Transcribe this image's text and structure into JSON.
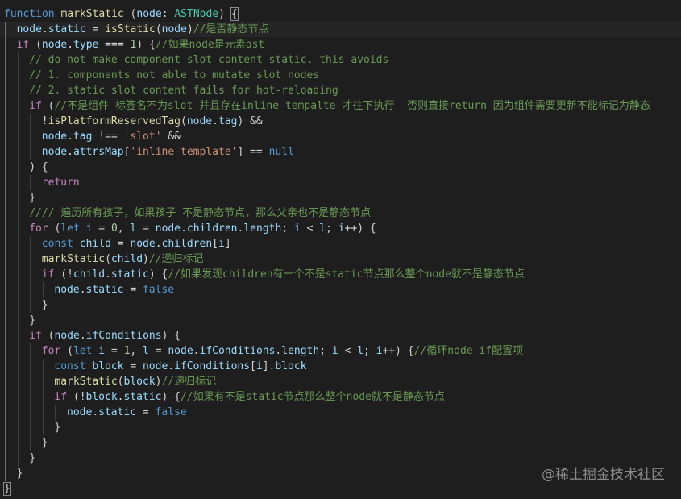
{
  "watermark": "@稀土掘金技术社区",
  "colors": {
    "background": "#1e1e1e",
    "keyword": "#569cd6",
    "control": "#c586c0",
    "function": "#dcdcaa",
    "variable": "#9cdcfe",
    "type": "#4ec9b0",
    "number": "#b5cea8",
    "string": "#ce9178",
    "comment": "#6a9955"
  },
  "lines": [
    {
      "indent": 0,
      "tokens": [
        [
          "kw",
          "function"
        ],
        [
          "pun",
          " "
        ],
        [
          "fn",
          "markStatic"
        ],
        [
          "pun",
          " ("
        ],
        [
          "var",
          "node"
        ],
        [
          "pun",
          ": "
        ],
        [
          "ty",
          "ASTNode"
        ],
        [
          "pun",
          ") {"
        ]
      ]
    },
    {
      "indent": 1,
      "tokens": [
        [
          "var",
          "node"
        ],
        [
          "pun",
          "."
        ],
        [
          "var",
          "static"
        ],
        [
          "pun",
          " = "
        ],
        [
          "fn",
          "isStatic"
        ],
        [
          "pun",
          "("
        ],
        [
          "var",
          "node"
        ],
        [
          "pun",
          ")"
        ],
        [
          "cmt",
          "//是否静态节点"
        ]
      ]
    },
    {
      "indent": 1,
      "tokens": [
        [
          "ctl",
          "if"
        ],
        [
          "pun",
          " ("
        ],
        [
          "var",
          "node"
        ],
        [
          "pun",
          "."
        ],
        [
          "var",
          "type"
        ],
        [
          "pun",
          " === "
        ],
        [
          "num",
          "1"
        ],
        [
          "pun",
          ") {"
        ],
        [
          "cmt",
          "//如果node是元素ast"
        ]
      ]
    },
    {
      "indent": 2,
      "tokens": [
        [
          "cmt",
          "// do not make component slot content static. this avoids"
        ]
      ]
    },
    {
      "indent": 2,
      "tokens": [
        [
          "cmt",
          "// 1. components not able to mutate slot nodes"
        ]
      ]
    },
    {
      "indent": 2,
      "tokens": [
        [
          "cmt",
          "// 2. static slot content fails for hot-reloading"
        ]
      ]
    },
    {
      "indent": 2,
      "tokens": [
        [
          "ctl",
          "if"
        ],
        [
          "pun",
          " ("
        ],
        [
          "cmt",
          "//不是组件 标签名不为slot 并且存在inline-tempalte 才往下执行  否则直接return 因为组件需要更新不能标记为静态"
        ]
      ]
    },
    {
      "indent": 3,
      "tokens": [
        [
          "pun",
          "!"
        ],
        [
          "fn",
          "isPlatformReservedTag"
        ],
        [
          "pun",
          "("
        ],
        [
          "var",
          "node"
        ],
        [
          "pun",
          "."
        ],
        [
          "var",
          "tag"
        ],
        [
          "pun",
          ") &&"
        ]
      ]
    },
    {
      "indent": 3,
      "tokens": [
        [
          "var",
          "node"
        ],
        [
          "pun",
          "."
        ],
        [
          "var",
          "tag"
        ],
        [
          "pun",
          " !== "
        ],
        [
          "str",
          "'slot'"
        ],
        [
          "pun",
          " &&"
        ]
      ]
    },
    {
      "indent": 3,
      "tokens": [
        [
          "var",
          "node"
        ],
        [
          "pun",
          "."
        ],
        [
          "var",
          "attrsMap"
        ],
        [
          "pun",
          "["
        ],
        [
          "str",
          "'inline-template'"
        ],
        [
          "pun",
          "] == "
        ],
        [
          "kw",
          "null"
        ]
      ]
    },
    {
      "indent": 2,
      "tokens": [
        [
          "pun",
          ") {"
        ]
      ]
    },
    {
      "indent": 3,
      "tokens": [
        [
          "ctl",
          "return"
        ]
      ]
    },
    {
      "indent": 2,
      "tokens": [
        [
          "pun",
          "}"
        ]
      ]
    },
    {
      "indent": 2,
      "tokens": [
        [
          "cmt",
          "//// 遍历所有孩子，如果孩子 不是静态节点，那么父亲也不是静态节点"
        ]
      ]
    },
    {
      "indent": 2,
      "tokens": [
        [
          "ctl",
          "for"
        ],
        [
          "pun",
          " ("
        ],
        [
          "kw",
          "let"
        ],
        [
          "pun",
          " "
        ],
        [
          "var",
          "i"
        ],
        [
          "pun",
          " = "
        ],
        [
          "num",
          "0"
        ],
        [
          "pun",
          ", "
        ],
        [
          "var",
          "l"
        ],
        [
          "pun",
          " = "
        ],
        [
          "var",
          "node"
        ],
        [
          "pun",
          "."
        ],
        [
          "var",
          "children"
        ],
        [
          "pun",
          "."
        ],
        [
          "var",
          "length"
        ],
        [
          "pun",
          "; "
        ],
        [
          "var",
          "i"
        ],
        [
          "pun",
          " < "
        ],
        [
          "var",
          "l"
        ],
        [
          "pun",
          "; "
        ],
        [
          "var",
          "i"
        ],
        [
          "pun",
          "++) {"
        ]
      ]
    },
    {
      "indent": 3,
      "tokens": [
        [
          "kw",
          "const"
        ],
        [
          "pun",
          " "
        ],
        [
          "var",
          "child"
        ],
        [
          "pun",
          " = "
        ],
        [
          "var",
          "node"
        ],
        [
          "pun",
          "."
        ],
        [
          "var",
          "children"
        ],
        [
          "pun",
          "["
        ],
        [
          "var",
          "i"
        ],
        [
          "pun",
          "]"
        ]
      ]
    },
    {
      "indent": 3,
      "tokens": [
        [
          "fn",
          "markStatic"
        ],
        [
          "pun",
          "("
        ],
        [
          "var",
          "child"
        ],
        [
          "pun",
          ")"
        ],
        [
          "cmt",
          "//递归标记"
        ]
      ]
    },
    {
      "indent": 3,
      "tokens": [
        [
          "ctl",
          "if"
        ],
        [
          "pun",
          " (!"
        ],
        [
          "var",
          "child"
        ],
        [
          "pun",
          "."
        ],
        [
          "var",
          "static"
        ],
        [
          "pun",
          ") {"
        ],
        [
          "cmt",
          "//如果发现children有一个不是static节点那么整个node就不是静态节点"
        ]
      ]
    },
    {
      "indent": 4,
      "tokens": [
        [
          "var",
          "node"
        ],
        [
          "pun",
          "."
        ],
        [
          "var",
          "static"
        ],
        [
          "pun",
          " = "
        ],
        [
          "kw",
          "false"
        ]
      ]
    },
    {
      "indent": 3,
      "tokens": [
        [
          "pun",
          "}"
        ]
      ]
    },
    {
      "indent": 2,
      "tokens": [
        [
          "pun",
          "}"
        ]
      ]
    },
    {
      "indent": 2,
      "tokens": [
        [
          "ctl",
          "if"
        ],
        [
          "pun",
          " ("
        ],
        [
          "var",
          "node"
        ],
        [
          "pun",
          "."
        ],
        [
          "var",
          "ifConditions"
        ],
        [
          "pun",
          ") {"
        ]
      ]
    },
    {
      "indent": 3,
      "tokens": [
        [
          "ctl",
          "for"
        ],
        [
          "pun",
          " ("
        ],
        [
          "kw",
          "let"
        ],
        [
          "pun",
          " "
        ],
        [
          "var",
          "i"
        ],
        [
          "pun",
          " = "
        ],
        [
          "num",
          "1"
        ],
        [
          "pun",
          ", "
        ],
        [
          "var",
          "l"
        ],
        [
          "pun",
          " = "
        ],
        [
          "var",
          "node"
        ],
        [
          "pun",
          "."
        ],
        [
          "var",
          "ifConditions"
        ],
        [
          "pun",
          "."
        ],
        [
          "var",
          "length"
        ],
        [
          "pun",
          "; "
        ],
        [
          "var",
          "i"
        ],
        [
          "pun",
          " < "
        ],
        [
          "var",
          "l"
        ],
        [
          "pun",
          "; "
        ],
        [
          "var",
          "i"
        ],
        [
          "pun",
          "++) {"
        ],
        [
          "cmt",
          "//循环node if配置项"
        ]
      ]
    },
    {
      "indent": 4,
      "tokens": [
        [
          "kw",
          "const"
        ],
        [
          "pun",
          " "
        ],
        [
          "var",
          "block"
        ],
        [
          "pun",
          " = "
        ],
        [
          "var",
          "node"
        ],
        [
          "pun",
          "."
        ],
        [
          "var",
          "ifConditions"
        ],
        [
          "pun",
          "["
        ],
        [
          "var",
          "i"
        ],
        [
          "pun",
          "]."
        ],
        [
          "var",
          "block"
        ]
      ]
    },
    {
      "indent": 4,
      "tokens": [
        [
          "fn",
          "markStatic"
        ],
        [
          "pun",
          "("
        ],
        [
          "var",
          "block"
        ],
        [
          "pun",
          ")"
        ],
        [
          "cmt",
          "//递归标记"
        ]
      ]
    },
    {
      "indent": 4,
      "tokens": [
        [
          "ctl",
          "if"
        ],
        [
          "pun",
          " (!"
        ],
        [
          "var",
          "block"
        ],
        [
          "pun",
          "."
        ],
        [
          "var",
          "static"
        ],
        [
          "pun",
          ") {"
        ],
        [
          "cmt",
          "//如果有不是static节点那么整个node就不是静态节点"
        ]
      ]
    },
    {
      "indent": 5,
      "tokens": [
        [
          "var",
          "node"
        ],
        [
          "pun",
          "."
        ],
        [
          "var",
          "static"
        ],
        [
          "pun",
          " = "
        ],
        [
          "kw",
          "false"
        ]
      ]
    },
    {
      "indent": 4,
      "tokens": [
        [
          "pun",
          "}"
        ]
      ]
    },
    {
      "indent": 3,
      "tokens": [
        [
          "pun",
          "}"
        ]
      ]
    },
    {
      "indent": 2,
      "tokens": [
        [
          "pun",
          "}"
        ]
      ]
    },
    {
      "indent": 1,
      "tokens": [
        [
          "pun",
          "}"
        ]
      ]
    },
    {
      "indent": 0,
      "tokens": [
        [
          "pun",
          "}"
        ]
      ]
    }
  ]
}
